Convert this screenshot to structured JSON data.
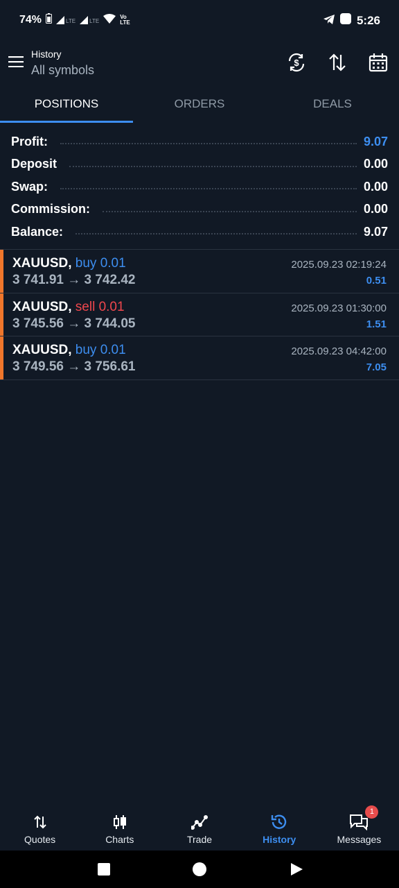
{
  "status_bar": {
    "battery": "74%",
    "signal1": "LTE",
    "signal2": "LTE",
    "volte_top": "Vo",
    "volte_bottom": "LTE",
    "time": "5:26"
  },
  "header": {
    "section": "History",
    "filter": "All symbols",
    "icons": [
      "menu-icon",
      "currency-sync-icon",
      "sort-icon",
      "calendar-icon"
    ]
  },
  "tabs": [
    {
      "label": "POSITIONS",
      "active": true
    },
    {
      "label": "ORDERS",
      "active": false
    },
    {
      "label": "DEALS",
      "active": false
    }
  ],
  "summary": [
    {
      "label": "Profit:",
      "value": "9.07",
      "highlight": true
    },
    {
      "label": "Deposit",
      "value": "0.00",
      "highlight": false
    },
    {
      "label": "Swap:",
      "value": "0.00",
      "highlight": false
    },
    {
      "label": "Commission:",
      "value": "0.00",
      "highlight": false
    },
    {
      "label": "Balance:",
      "value": "9.07",
      "highlight": false
    }
  ],
  "positions": [
    {
      "symbol": "XAUUSD,",
      "side": "buy 0.01",
      "type": "buy",
      "prices": "3 741.91 → 3 742.42",
      "time": "2025.09.23 02:19:24",
      "profit": "0.51"
    },
    {
      "symbol": "XAUUSD,",
      "side": "sell 0.01",
      "type": "sell",
      "prices": "3 745.56 → 3 744.05",
      "time": "2025.09.23 01:30:00",
      "profit": "1.51"
    },
    {
      "symbol": "XAUUSD,",
      "side": "buy 0.01",
      "type": "buy",
      "prices": "3 749.56 → 3 756.61",
      "time": "2025.09.23 04:42:00",
      "profit": "7.05"
    }
  ],
  "bottom_nav": [
    {
      "label": "Quotes",
      "icon": "quotes-icon",
      "active": false
    },
    {
      "label": "Charts",
      "icon": "charts-icon",
      "active": false
    },
    {
      "label": "Trade",
      "icon": "trade-icon",
      "active": false
    },
    {
      "label": "History",
      "icon": "history-icon",
      "active": true
    },
    {
      "label": "Messages",
      "icon": "messages-icon",
      "active": false,
      "badge": "1"
    }
  ],
  "colors": {
    "background": "#111925",
    "accent": "#3d8ef0",
    "sell": "#f0474d",
    "position_bar": "#f0762b"
  }
}
